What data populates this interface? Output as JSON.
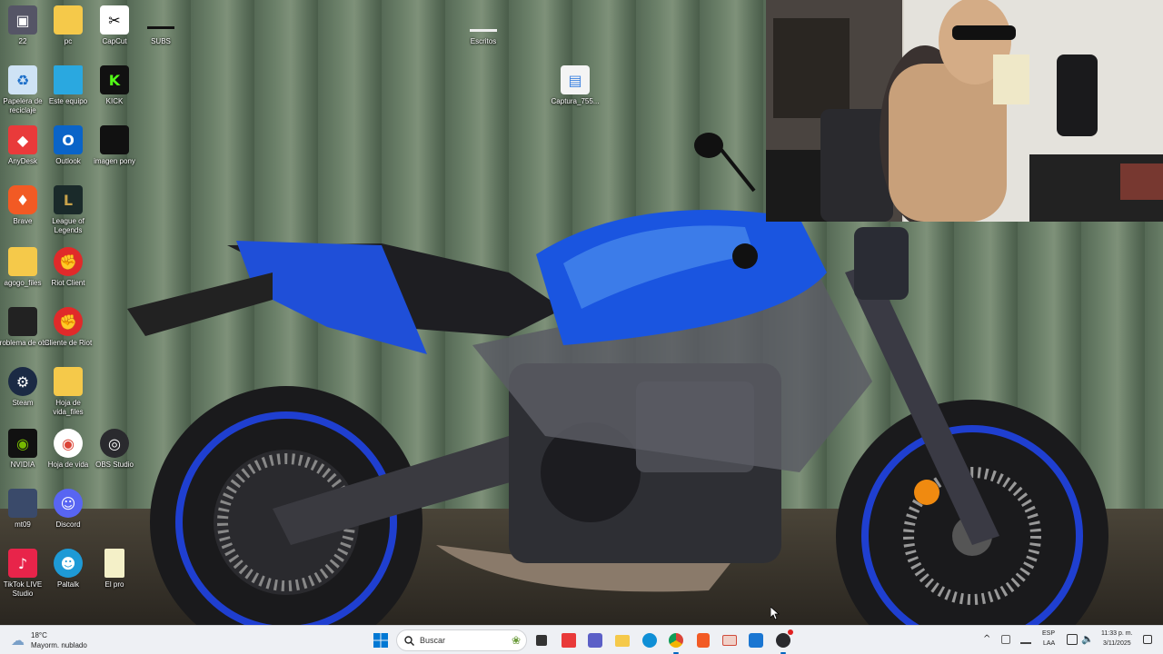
{
  "desktop_icons": [
    {
      "label": "22"
    },
    {
      "label": "pc"
    },
    {
      "label": "CapCut"
    },
    {
      "label": "SUBS"
    },
    {
      "label": "Escritos"
    },
    {
      "label": "Captura_755..."
    },
    {
      "label": "Papelera de reciclaje"
    },
    {
      "label": "Este equipo"
    },
    {
      "label": "KICK"
    },
    {
      "label": "AnyDesk"
    },
    {
      "label": "Outlook"
    },
    {
      "label": "imagen pony"
    },
    {
      "label": "Brave"
    },
    {
      "label": "League of Legends"
    },
    {
      "label": "agogo_files"
    },
    {
      "label": "Riot Client"
    },
    {
      "label": "problema de obs"
    },
    {
      "label": "Cliente de Riot"
    },
    {
      "label": "Steam"
    },
    {
      "label": "Hoja de vida_files"
    },
    {
      "label": "NVIDIA"
    },
    {
      "label": "Hoja de vida"
    },
    {
      "label": "OBS Studio"
    },
    {
      "label": "mt09"
    },
    {
      "label": "Discord"
    },
    {
      "label": "TikTok LIVE Studio"
    },
    {
      "label": "Paltalk"
    },
    {
      "label": "El pro"
    }
  ],
  "taskbar": {
    "weather_temp": "18°C",
    "weather_desc": "Mayorm. nublado",
    "search_placeholder": "Buscar",
    "apps": [
      "start-icon",
      "task-view-icon",
      "anydesk-icon",
      "teams-icon",
      "file-explorer-icon",
      "edge-icon",
      "chrome-icon",
      "brave-icon",
      "mail-icon",
      "store-icon",
      "obs-icon"
    ],
    "lang_top": "ESP",
    "lang_bottom": "LAA",
    "time": "11:33 p. m.",
    "date": "3/11/2025"
  },
  "colors": {
    "taskbar_bg": "#eef0f4",
    "accent": "#0067c0",
    "moto_blue": "#1a4fd8"
  }
}
